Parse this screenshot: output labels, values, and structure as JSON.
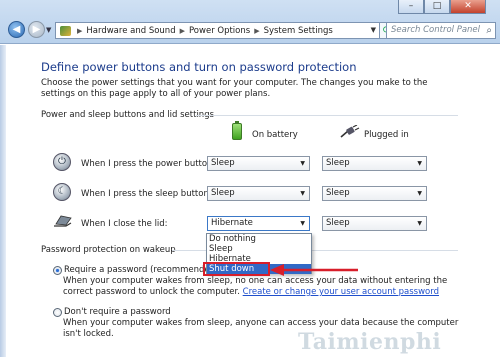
{
  "window": {
    "minimize_label": "–",
    "maximize_label": "□",
    "close_label": "✕"
  },
  "nav": {
    "back_glyph": "◀",
    "forward_glyph": "▶",
    "dropdown_glyph": "▼",
    "breadcrumb": [
      "Hardware and Sound",
      "Power Options",
      "System Settings"
    ],
    "breadcrumb_sep": "▶",
    "refresh_glyph": "⟳",
    "search_placeholder": "Search Control Panel",
    "search_icon": "⌕"
  },
  "page": {
    "title": "Define power buttons and turn on password protection",
    "description": "Choose the power settings that you want for your computer. The changes you make to the settings on this page apply to all of your power plans.",
    "section_buttons": "Power and sleep buttons and lid settings",
    "col_battery": "On battery",
    "col_plugged": "Plugged in",
    "rows": [
      {
        "label": "When I press the power button:",
        "battery": "Sleep",
        "plugged": "Sleep",
        "icon": "power-button-icon"
      },
      {
        "label": "When I press the sleep button:",
        "battery": "Sleep",
        "plugged": "Sleep",
        "icon": "sleep-button-icon"
      },
      {
        "label": "When I close the lid:",
        "battery": "Hibernate",
        "plugged": "Sleep",
        "icon": "laptop-lid-icon"
      }
    ],
    "dropdown_options": [
      "Do nothing",
      "Sleep",
      "Hibernate",
      "Shut down"
    ],
    "dropdown_selected_index": 3,
    "section_password": "Password protection on wakeup",
    "require_label": "Require a password (recommended)",
    "require_help": "When your computer wakes from sleep, no one can access your data without entering the correct password to unlock the computer.",
    "require_link": "Create or change your user account password",
    "dont_require_label": "Don't require a password",
    "dont_require_help": "When your computer wakes from sleep, anyone can access your data because the computer isn't locked.",
    "watermark": "Taimienphi",
    "arrow_color": "#d81e2a"
  }
}
